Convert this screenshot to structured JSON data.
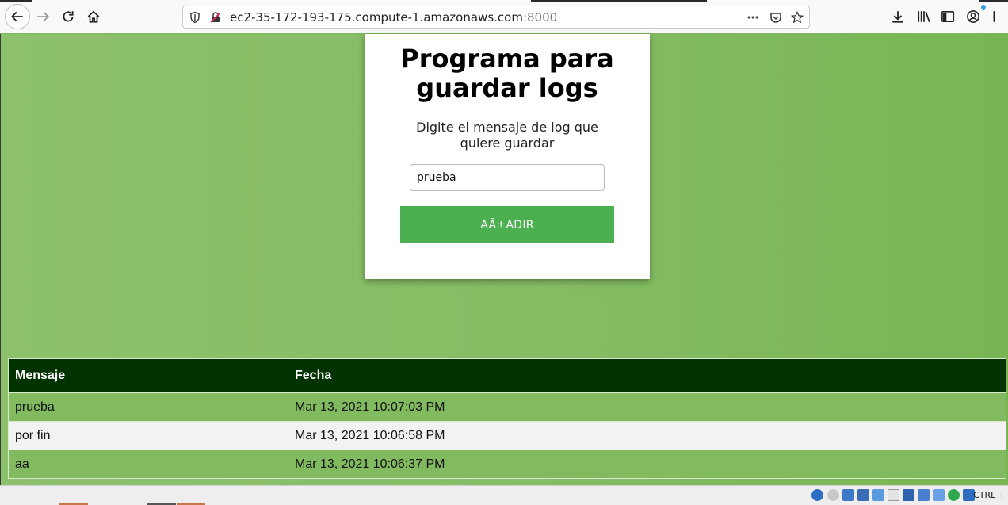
{
  "browser": {
    "url_host": "ec2-35-172-193-175.compute-1.amazonaws.com",
    "url_port": ":8000",
    "icons": [
      "back-arrow-icon",
      "forward-arrow-icon",
      "reload-icon",
      "home-icon",
      "shield-icon",
      "insecure-lock-icon",
      "page-actions-icon",
      "pocket-icon",
      "bookmark-star-icon",
      "download-icon",
      "library-icon",
      "sidebar-icon",
      "account-icon",
      "menu-icon"
    ]
  },
  "form": {
    "title": "Programa para guardar logs",
    "subtitle": "Digite el mensaje de log que quiere guardar",
    "input_value": "prueba",
    "button_label": "AÃ±ADIR"
  },
  "table": {
    "headers": [
      "Mensaje",
      "Fecha"
    ],
    "rows": [
      {
        "mensaje": "prueba",
        "fecha": "Mar 13, 2021 10:07:03 PM"
      },
      {
        "mensaje": "por fin",
        "fecha": "Mar 13, 2021 10:06:58 PM"
      },
      {
        "mensaje": "aa",
        "fecha": "Mar 13, 2021 10:06:37 PM"
      }
    ]
  },
  "statusbar": {
    "host_key_text": "CTRL +"
  },
  "colors": {
    "page_green": "#86bd65",
    "button_green": "#4caf50",
    "header_dark_green": "#003300",
    "row_green": "#82ba60",
    "row_grey": "#f2f2f2"
  }
}
